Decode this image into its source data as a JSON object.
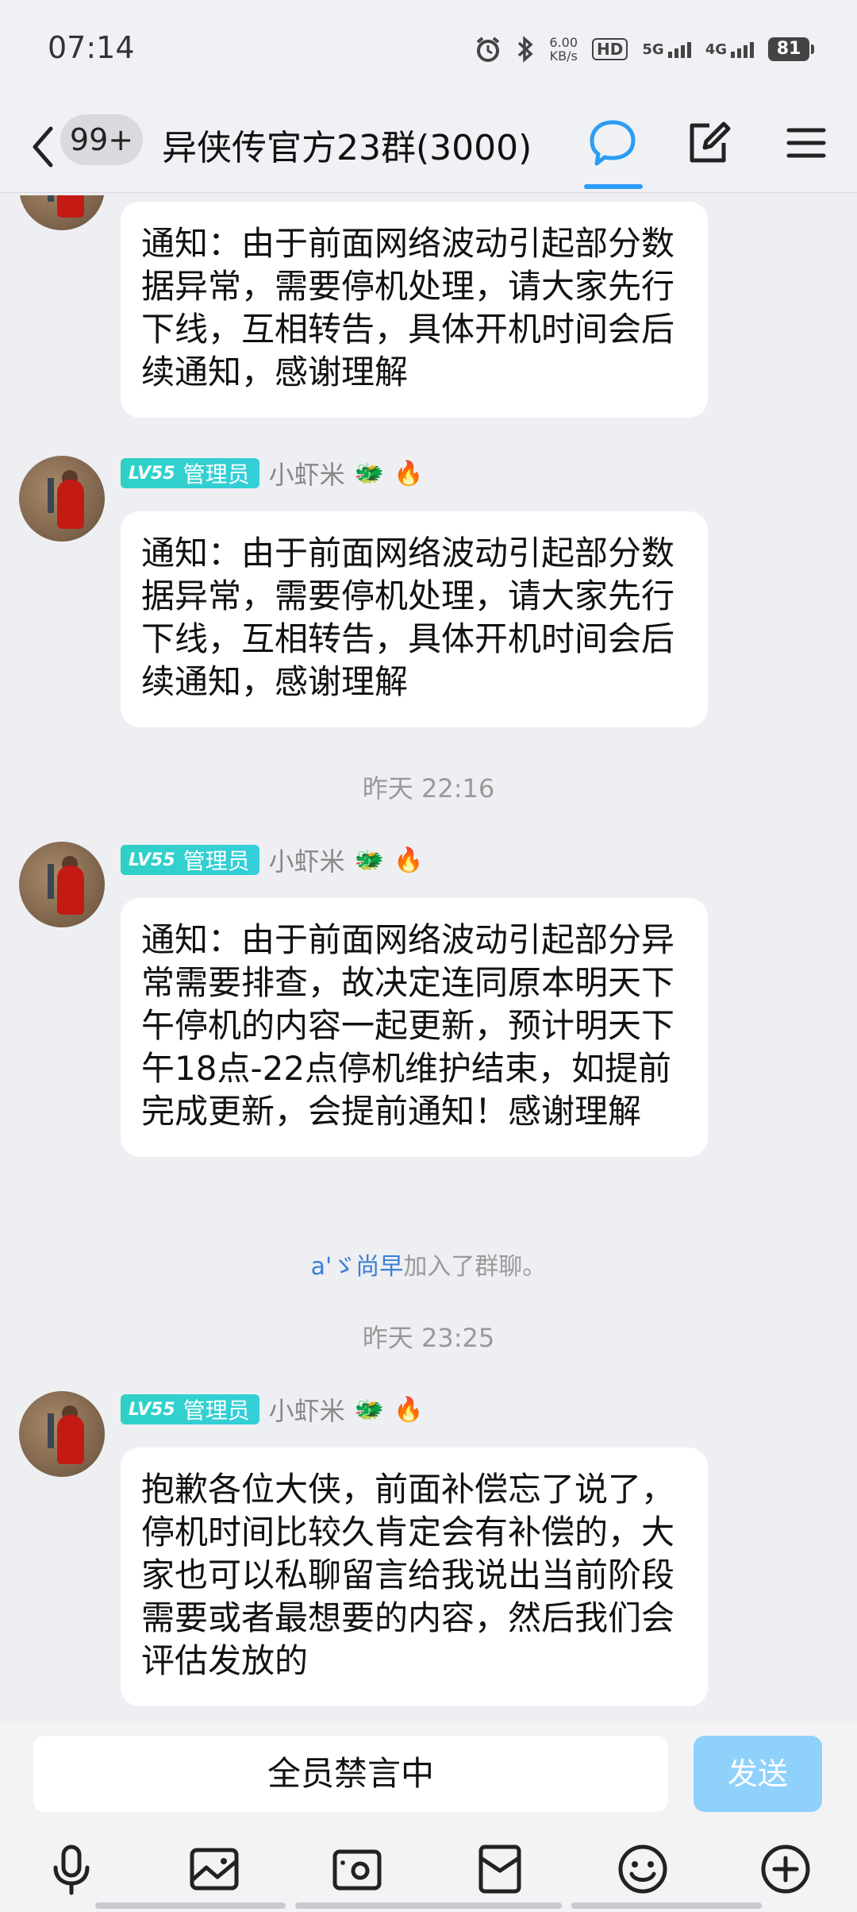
{
  "status_bar": {
    "time": "07:14",
    "net_speed_value": "6.00",
    "net_speed_unit": "KB/s",
    "hd_label": "HD",
    "sim1": "5G",
    "sim2": "4G",
    "battery": "81"
  },
  "header": {
    "unread_badge": "99+",
    "title": "异侠传官方23群(3000)"
  },
  "messages": [
    {
      "text": "通知：由于前面网络波动引起部分数据异常，需要停机处理，请大家先行下线，互相转告，具体开机时间会后续通知，感谢理解"
    },
    {
      "level": "LV55",
      "role": "管理员",
      "sender": "小虾米",
      "emoji1": "🐲",
      "emoji2": "🔥",
      "text": "通知：由于前面网络波动引起部分数据异常，需要停机处理，请大家先行下线，互相转告，具体开机时间会后续通知，感谢理解"
    },
    {
      "level": "LV55",
      "role": "管理员",
      "sender": "小虾米",
      "emoji1": "🐲",
      "emoji2": "🔥",
      "text": "通知：由于前面网络波动引起部分异常需要排查，故决定连同原本明天下午停机的内容一起更新，预计明天下午18点-22点停机维护结束，如提前完成更新，会提前通知！感谢理解"
    },
    {
      "level": "LV55",
      "role": "管理员",
      "sender": "小虾米",
      "emoji1": "🐲",
      "emoji2": "🔥",
      "text": "抱歉各位大侠，前面补偿忘了说了，停机时间比较久肯定会有补偿的，大家也可以私聊留言给我说出当前阶段需要或者最想要的内容，然后我们会评估发放的"
    }
  ],
  "timestamps": [
    "昨天 22:16",
    "昨天 23:25"
  ],
  "system_note": {
    "user": "a'ゞ尚早",
    "text": "加入了群聊。"
  },
  "input": {
    "muted_text": "全员禁言中",
    "send_label": "发送"
  },
  "toolbar_icons": [
    "microphone-icon",
    "image-icon",
    "camera-icon",
    "red-packet-icon",
    "emoji-icon",
    "plus-icon"
  ],
  "colors": {
    "accent": "#2a9cf6",
    "level_badge": "#2fd0c6",
    "send_disabled": "#8fd1fb",
    "background": "#eeeff3"
  }
}
